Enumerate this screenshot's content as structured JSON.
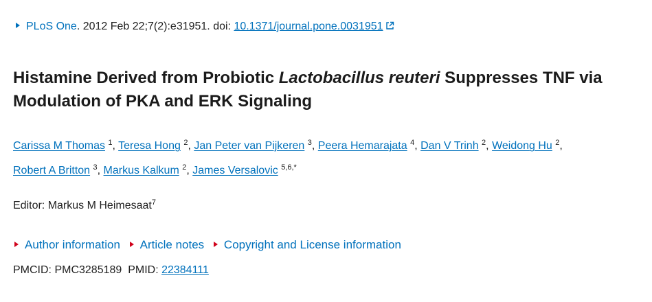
{
  "citation": {
    "journal": "PLoS One",
    "details": ". 2012 Feb 22;7(2):e31951. doi: ",
    "doi": "10.1371/journal.pone.0031951",
    "external_link_icon": "external-link-icon"
  },
  "title": {
    "part1": "Histamine Derived from Probiotic ",
    "italic": "Lactobacillus reuteri",
    "part2": " Suppresses TNF via Modulation of PKA and ERK Signaling"
  },
  "authors": [
    {
      "name": "Carissa M Thomas",
      "aff": "1"
    },
    {
      "name": "Teresa Hong",
      "aff": "2"
    },
    {
      "name": "Jan Peter van Pijkeren",
      "aff": "3"
    },
    {
      "name": "Peera Hemarajata",
      "aff": "4"
    },
    {
      "name": "Dan V Trinh",
      "aff": "2"
    },
    {
      "name": "Weidong Hu",
      "aff": "2"
    },
    {
      "name": "Robert A Britton",
      "aff": "3"
    },
    {
      "name": "Markus Kalkum",
      "aff": "2"
    },
    {
      "name": "James Versalovic",
      "aff": "5,6,*"
    }
  ],
  "editor": {
    "label": "Editor: Markus M Heimesaat",
    "aff": "7"
  },
  "accordions": [
    {
      "label": "Author information"
    },
    {
      "label": "Article notes"
    },
    {
      "label": "Copyright and License information"
    }
  ],
  "ids": {
    "pmcid_label": "PMCID: PMC3285189",
    "pmid_label": "PMID: ",
    "pmid": "22384111"
  },
  "colors": {
    "link": "#0071bc",
    "text": "#212121",
    "accordion_marker": "#d0021b"
  }
}
